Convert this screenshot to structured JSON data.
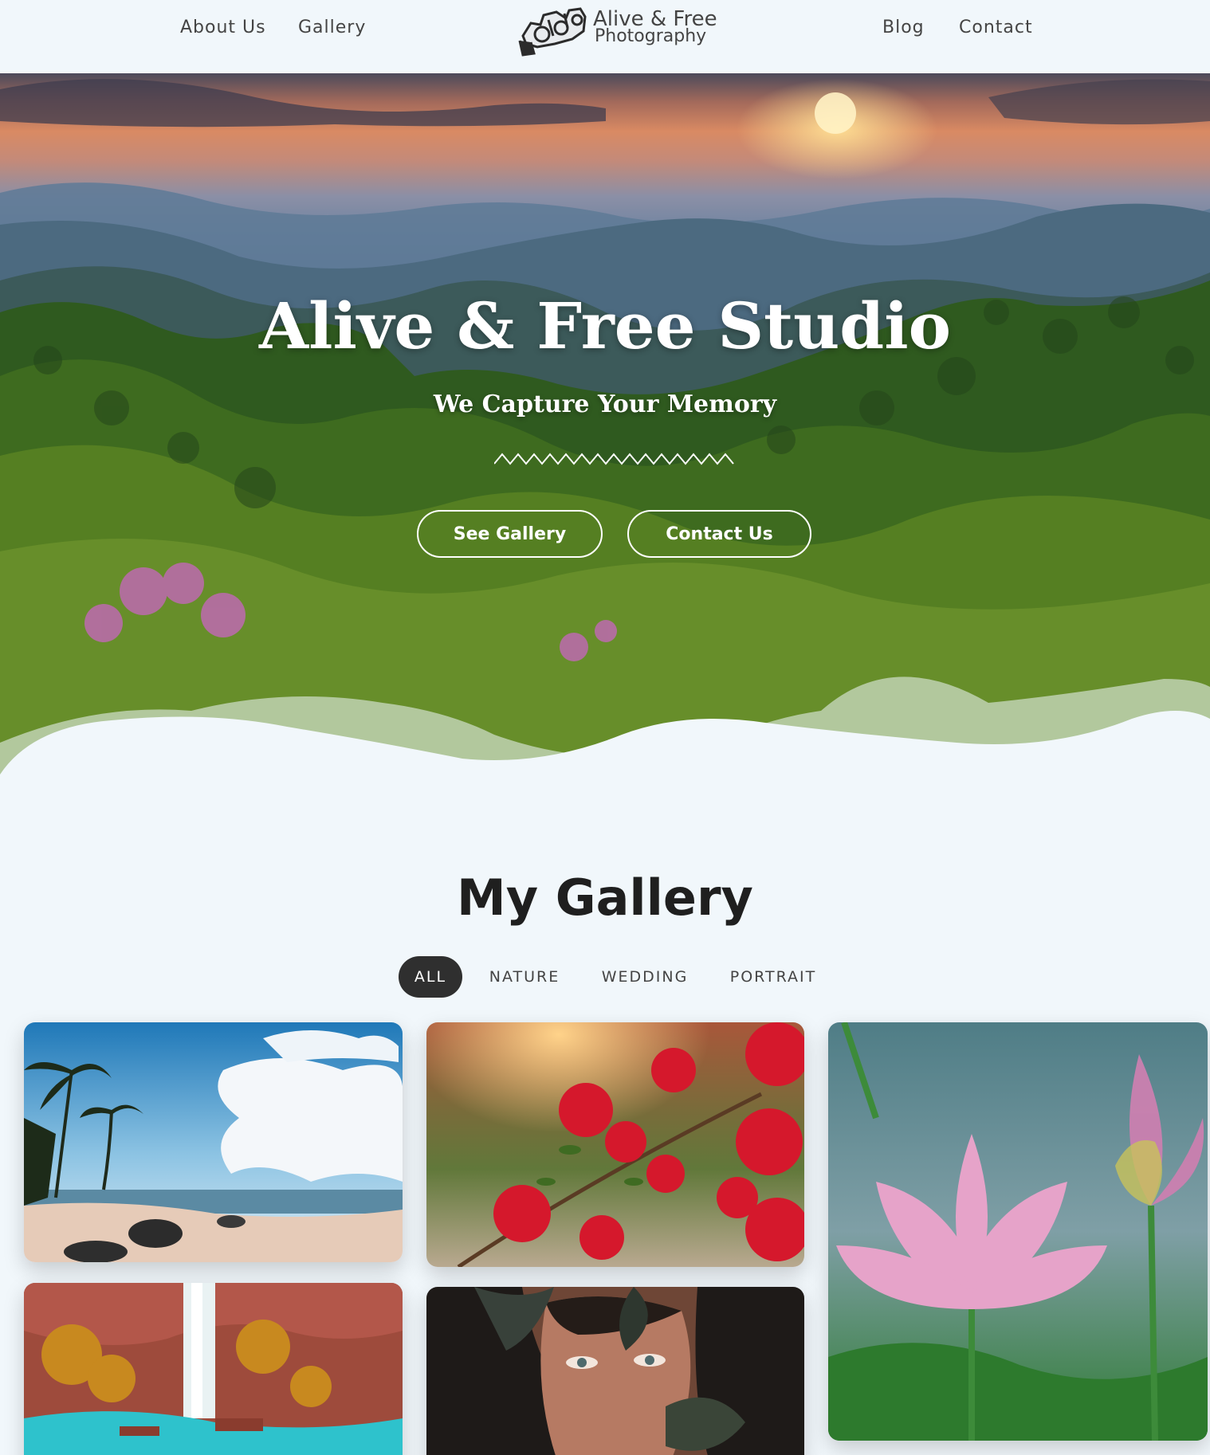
{
  "nav": {
    "about": "About Us",
    "gallery": "Gallery",
    "blog": "Blog",
    "contact": "Contact"
  },
  "logo": {
    "line1": "Alive & Free",
    "line2": "Photography"
  },
  "hero": {
    "title": "Alive & Free Studio",
    "subtitle": "We Capture Your Memory",
    "see_gallery": "See Gallery",
    "contact_us": "Contact Us"
  },
  "gallery": {
    "title": "My Gallery",
    "filters": [
      "ALL",
      "NATURE",
      "WEDDING",
      "PORTRAIT"
    ],
    "active_filter": "ALL"
  },
  "colors": {
    "background": "#f1f7fb",
    "active_filter": "#2f2f2f"
  }
}
